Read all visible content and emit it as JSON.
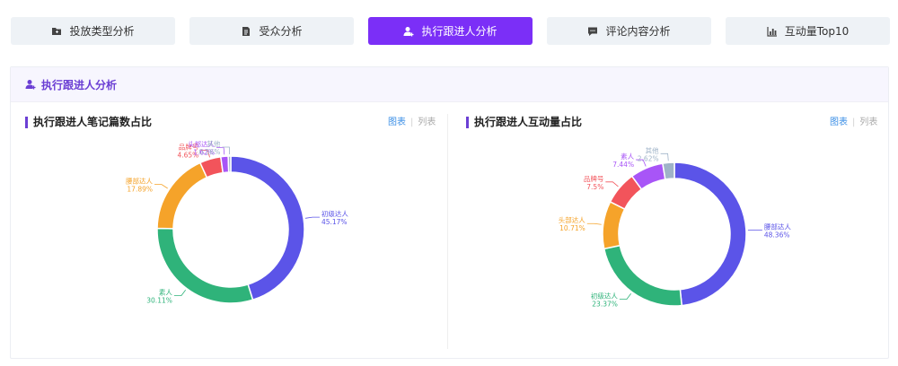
{
  "tabs": [
    {
      "label": "投放类型分析",
      "icon": "folder-icon",
      "active": false
    },
    {
      "label": "受众分析",
      "icon": "document-icon",
      "active": false
    },
    {
      "label": "执行跟进人分析",
      "icon": "user-add-icon",
      "active": true
    },
    {
      "label": "评论内容分析",
      "icon": "comment-icon",
      "active": false
    },
    {
      "label": "互动量Top10",
      "icon": "bar-chart-icon",
      "active": false
    }
  ],
  "section": {
    "title": "执行跟进人分析",
    "icon": "user-add-icon"
  },
  "toggle": {
    "chart_label": "图表",
    "list_label": "列表"
  },
  "colors": {
    "accent": "#7b2ff7",
    "header_text": "#6b3fd4",
    "link": "#3a8ee6"
  },
  "chart_data": [
    {
      "type": "pie",
      "variant": "donut",
      "title": "执行跟进人笔记篇数占比",
      "slices": [
        {
          "label": "初级达人",
          "value": 45.17,
          "display": "45.17%",
          "color": "#5b54e8"
        },
        {
          "label": "素人",
          "value": 30.11,
          "display": "30.11%",
          "color": "#2fb37a"
        },
        {
          "label": "腰部达人",
          "value": 17.89,
          "display": "17.89%",
          "color": "#f5a32a"
        },
        {
          "label": "品牌号",
          "value": 4.65,
          "display": "4.65%",
          "color": "#f2545b"
        },
        {
          "label": "头部达人",
          "value": 1.62,
          "display": "1.62%",
          "color": "#a855f7"
        },
        {
          "label": "其他",
          "value": 0.56,
          "display": "0.56%",
          "color": "#9fb3c8"
        }
      ]
    },
    {
      "type": "pie",
      "variant": "donut",
      "title": "执行跟进人互动量占比",
      "slices": [
        {
          "label": "腰部达人",
          "value": 48.36,
          "display": "48.36%",
          "color": "#5b54e8"
        },
        {
          "label": "初级达人",
          "value": 23.37,
          "display": "23.37%",
          "color": "#2fb37a"
        },
        {
          "label": "头部达人",
          "value": 10.71,
          "display": "10.71%",
          "color": "#f5a32a"
        },
        {
          "label": "品牌号",
          "value": 7.5,
          "display": "7.5%",
          "color": "#f2545b"
        },
        {
          "label": "素人",
          "value": 7.44,
          "display": "7.44%",
          "color": "#a855f7"
        },
        {
          "label": "其他",
          "value": 2.62,
          "display": "2.62%",
          "color": "#9fb3c8"
        }
      ]
    }
  ]
}
